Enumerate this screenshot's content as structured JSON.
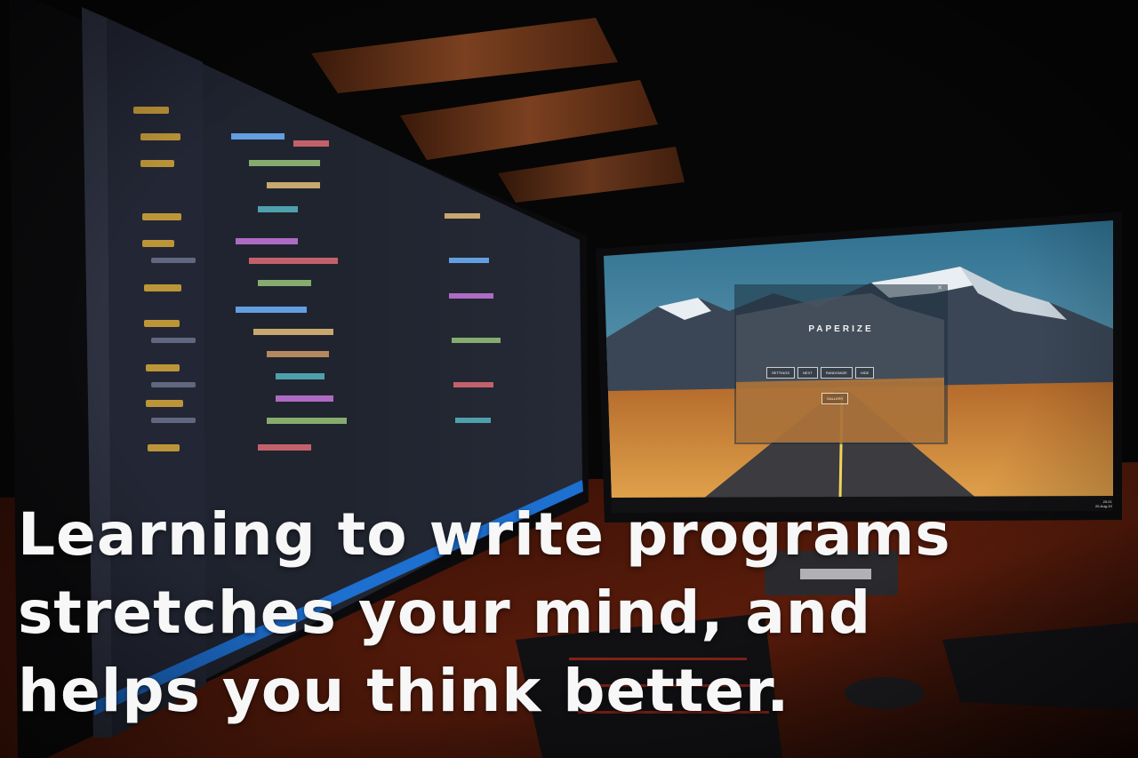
{
  "caption": {
    "lines": [
      "Learning to write programs",
      "stretches your mind, and",
      "helps you think better."
    ]
  },
  "right_monitor": {
    "app": {
      "title": "PAPERIZE",
      "buttons": [
        "SETTINGS",
        "NEXT",
        "RANDOMIZE",
        "HIDE"
      ],
      "gallery_label": "GALLERY"
    },
    "clock": {
      "time": "20:21",
      "date": "20-Aug-19"
    }
  },
  "colors": {
    "caption_text": "#f7f7f7",
    "room_background": "#070707",
    "shelf_wood": "#6b3a1e",
    "sky": "#3e7f9a",
    "desert": "#d7923f"
  },
  "icons": [
    "paperize-app-icon",
    "taskbar-start-icon"
  ]
}
